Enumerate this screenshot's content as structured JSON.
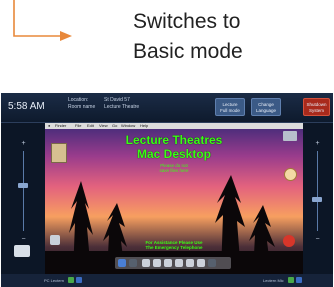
{
  "annotation": {
    "line1": "Switches to",
    "line2": "Basic mode",
    "arrow_color": "#e8883a"
  },
  "topbar": {
    "time": "5:58 AM",
    "location_label_1": "Location:",
    "location_label_2": "Room name",
    "location_value_1": "St David 57",
    "location_value_2": "Lecture Theatre",
    "btn_a_1": "Lecture",
    "btn_a_2": "Full mode",
    "btn_b_1": "Change",
    "btn_b_2": "Language",
    "btn_c_1": "Shutdown",
    "btn_c_2": "System",
    "accent_blue": "#3b5a86",
    "accent_red": "#a92a1c"
  },
  "screen": {
    "menubar_items": [
      "Finder",
      "File",
      "Edit",
      "View",
      "Go",
      "Window",
      "Help"
    ],
    "title_line1": "Lecture Theatres",
    "title_line2": "Mac Desktop",
    "subtitle_line1": "Please do not",
    "subtitle_line2": "save files here",
    "footer_line1": "For Assistance Please Use",
    "footer_line2": "The Emergency Telephone",
    "text_color": "#39ff14"
  },
  "bottombar": {
    "left_label": "PC Lectern",
    "right_label": "Lectern Mic"
  },
  "icons": {
    "arrow": "right-arrow-icon",
    "volume_up": "plus-icon",
    "volume_down": "minus-icon"
  }
}
